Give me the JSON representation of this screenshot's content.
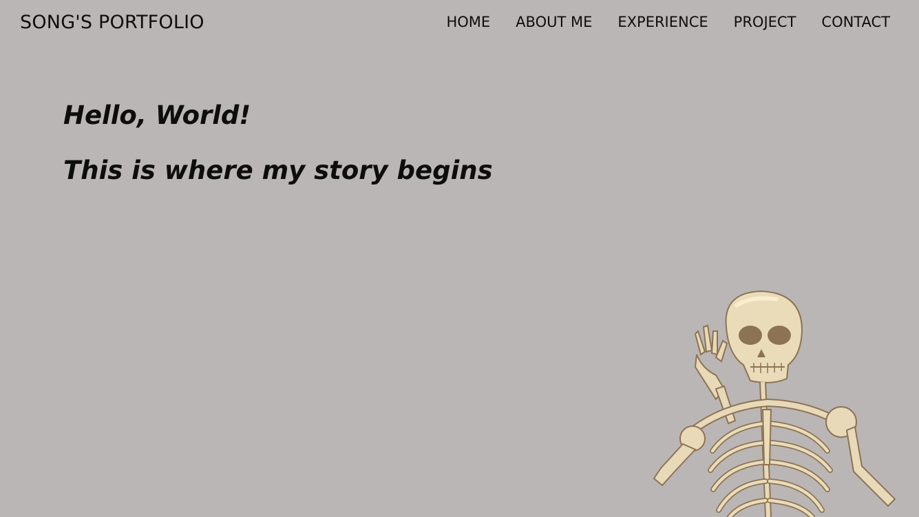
{
  "brand": "SONG'S PORTFOLIO",
  "nav": {
    "items": [
      {
        "label": "HOME"
      },
      {
        "label": "ABOUT ME"
      },
      {
        "label": "EXPERIENCE"
      },
      {
        "label": "PROJECT"
      },
      {
        "label": "CONTACT"
      }
    ]
  },
  "hero": {
    "greeting": "Hello, World!",
    "tagline": "This is where my story begins"
  },
  "colors": {
    "background": "#bab6b5",
    "text": "#0d0d0d",
    "bone": "#e8d9b8",
    "bone_shadow": "#8c7353"
  },
  "illustration": {
    "icon": "skeleton-illustration"
  }
}
